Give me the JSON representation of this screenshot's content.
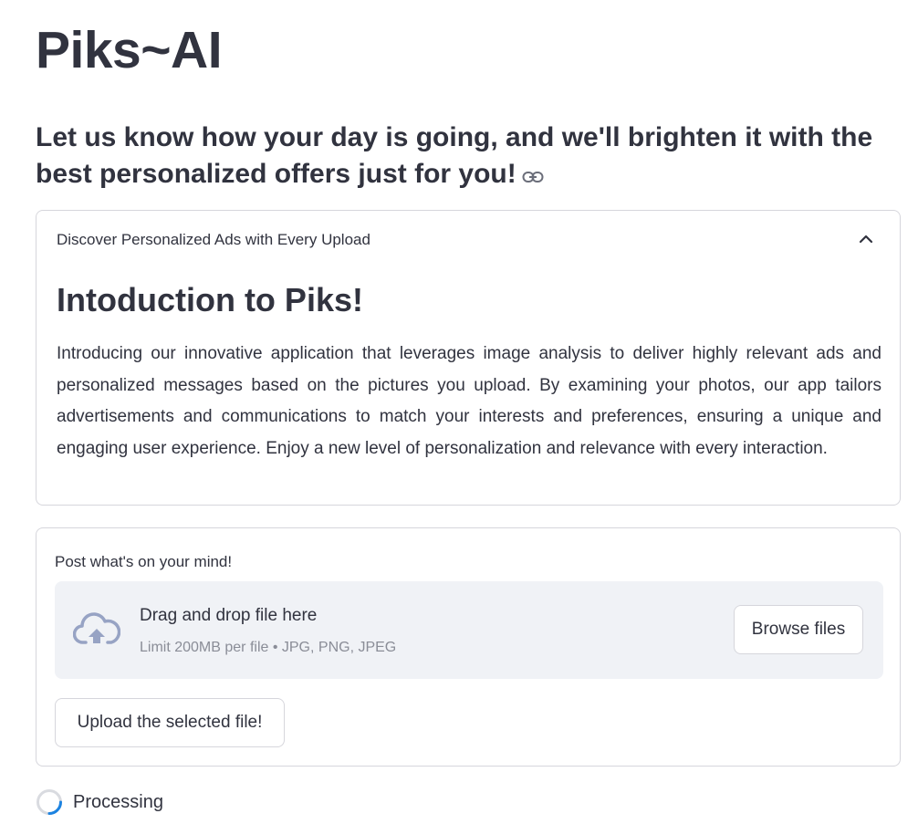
{
  "app": {
    "title": "Piks~AI",
    "subtitle": "Let us know how your day is going, and we'll brighten it with the best personalized offers just for you!"
  },
  "expander": {
    "label": "Discover Personalized Ads with Every Upload",
    "expanded": true,
    "intro_title": "Intoduction to Piks!",
    "intro_body": "Introducing our innovative application that leverages image analysis to deliver highly relevant ads and personalized messages based on the pictures you upload. By examining your photos, our app tailors advertisements and communications to match your interests and preferences, ensuring a unique and engaging user experience. Enjoy a new level of personalization and relevance with every interaction."
  },
  "uploader": {
    "label": "Post what's on your mind!",
    "dropzone_title": "Drag and drop file here",
    "dropzone_limit": "Limit 200MB per file • JPG, PNG, JPEG",
    "browse_label": "Browse files",
    "submit_label": "Upload the selected file!"
  },
  "status": {
    "text": "Processing"
  },
  "icons": {
    "link": "link-icon",
    "chevron": "chevron-up-icon",
    "upload": "cloud-upload-icon",
    "spinner": "spinner-icon"
  },
  "colors": {
    "text": "#31333f",
    "muted": "#8a8d97",
    "border": "#d6d6dc",
    "dropzone_bg": "#f0f2f6",
    "spinner_accent": "#1c83e1"
  }
}
